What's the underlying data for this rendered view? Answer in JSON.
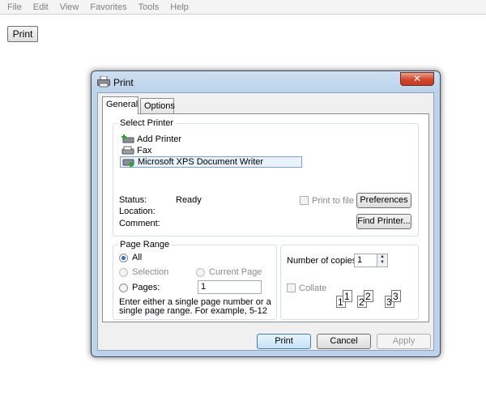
{
  "menu": [
    "File",
    "Edit",
    "View",
    "Favorites",
    "Tools",
    "Help"
  ],
  "page": {
    "print_button": "Print"
  },
  "dialog": {
    "title": "Print",
    "close_glyph": "✕",
    "tabs": [
      "General",
      "Options"
    ],
    "select_printer": {
      "title": "Select Printer",
      "printers": [
        "Add Printer",
        "Fax",
        "Microsoft XPS Document Writer"
      ],
      "selected_index": 2,
      "status_label": "Status:",
      "status_value": "Ready",
      "location_label": "Location:",
      "comment_label": "Comment:",
      "print_to_file_label": "Print to file",
      "print_to_file_checked": false,
      "preferences_button": "Preferences",
      "find_printer_button": "Find Printer..."
    },
    "page_range": {
      "title": "Page Range",
      "all_label": "All",
      "selection_label": "Selection",
      "current_page_label": "Current Page",
      "pages_label": "Pages:",
      "pages_value": "1",
      "selected": "All",
      "hint": "Enter either a single page number or a single page range.  For example, 5-12"
    },
    "copies": {
      "label": "Number of copies:",
      "value": "1",
      "collate_label": "Collate",
      "collate_checked": false,
      "collate_pages": [
        "1",
        "1",
        "2",
        "2",
        "3",
        "3"
      ]
    },
    "buttons": {
      "print": "Print",
      "cancel": "Cancel",
      "apply": "Apply"
    }
  },
  "colors": {
    "accent": "#2e6fbe",
    "frame": "#bcd3ea",
    "close": "#d2462d"
  }
}
